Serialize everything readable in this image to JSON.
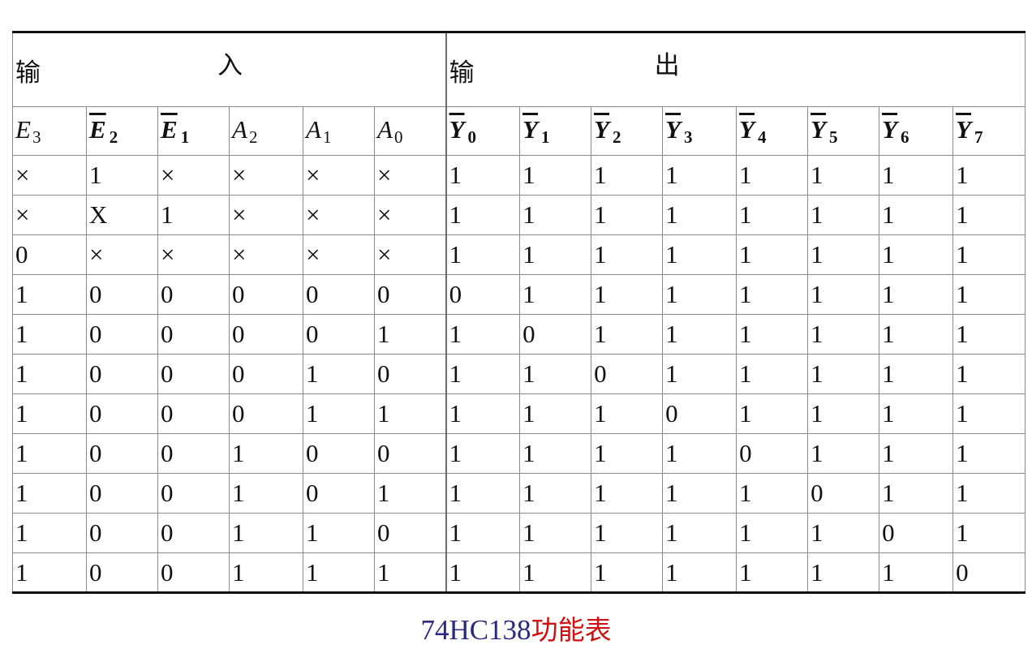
{
  "group_headers": {
    "input": [
      "输",
      "入"
    ],
    "output": [
      "输",
      "出"
    ]
  },
  "columns": {
    "inputs": [
      {
        "letter": "E",
        "index": "3",
        "overbar": false
      },
      {
        "letter": "E",
        "index": "2",
        "overbar": true
      },
      {
        "letter": "E",
        "index": "1",
        "overbar": true
      },
      {
        "letter": "A",
        "index": "2",
        "overbar": false
      },
      {
        "letter": "A",
        "index": "1",
        "overbar": false
      },
      {
        "letter": "A",
        "index": "0",
        "overbar": false
      }
    ],
    "outputs": [
      {
        "letter": "Y",
        "index": "0",
        "overbar": true
      },
      {
        "letter": "Y",
        "index": "1",
        "overbar": true
      },
      {
        "letter": "Y",
        "index": "2",
        "overbar": true
      },
      {
        "letter": "Y",
        "index": "3",
        "overbar": true
      },
      {
        "letter": "Y",
        "index": "4",
        "overbar": true
      },
      {
        "letter": "Y",
        "index": "5",
        "overbar": true
      },
      {
        "letter": "Y",
        "index": "6",
        "overbar": true
      },
      {
        "letter": "Y",
        "index": "7",
        "overbar": true
      }
    ]
  },
  "rows": [
    [
      "×",
      "1",
      "×",
      "×",
      "×",
      "×",
      "1",
      "1",
      "1",
      "1",
      "1",
      "1",
      "1",
      "1"
    ],
    [
      "×",
      "X",
      "1",
      "×",
      "×",
      "×",
      "1",
      "1",
      "1",
      "1",
      "1",
      "1",
      "1",
      "1"
    ],
    [
      "0",
      "×",
      "×",
      "×",
      "×",
      "×",
      "1",
      "1",
      "1",
      "1",
      "1",
      "1",
      "1",
      "1"
    ],
    [
      "1",
      "0",
      "0",
      "0",
      "0",
      "0",
      "0",
      "1",
      "1",
      "1",
      "1",
      "1",
      "1",
      "1"
    ],
    [
      "1",
      "0",
      "0",
      "0",
      "0",
      "1",
      "1",
      "0",
      "1",
      "1",
      "1",
      "1",
      "1",
      "1"
    ],
    [
      "1",
      "0",
      "0",
      "0",
      "1",
      "0",
      "1",
      "1",
      "0",
      "1",
      "1",
      "1",
      "1",
      "1"
    ],
    [
      "1",
      "0",
      "0",
      "0",
      "1",
      "1",
      "1",
      "1",
      "1",
      "0",
      "1",
      "1",
      "1",
      "1"
    ],
    [
      "1",
      "0",
      "0",
      "1",
      "0",
      "0",
      "1",
      "1",
      "1",
      "1",
      "0",
      "1",
      "1",
      "1"
    ],
    [
      "1",
      "0",
      "0",
      "1",
      "0",
      "1",
      "1",
      "1",
      "1",
      "1",
      "1",
      "0",
      "1",
      "1"
    ],
    [
      "1",
      "0",
      "0",
      "1",
      "1",
      "0",
      "1",
      "1",
      "1",
      "1",
      "1",
      "1",
      "0",
      "1"
    ],
    [
      "1",
      "0",
      "0",
      "1",
      "1",
      "1",
      "1",
      "1",
      "1",
      "1",
      "1",
      "1",
      "1",
      "0"
    ]
  ],
  "caption": {
    "part_a": "74HC138",
    "part_b": "功能表",
    "color_a": "#2a2a82",
    "color_b": "#d01010"
  }
}
